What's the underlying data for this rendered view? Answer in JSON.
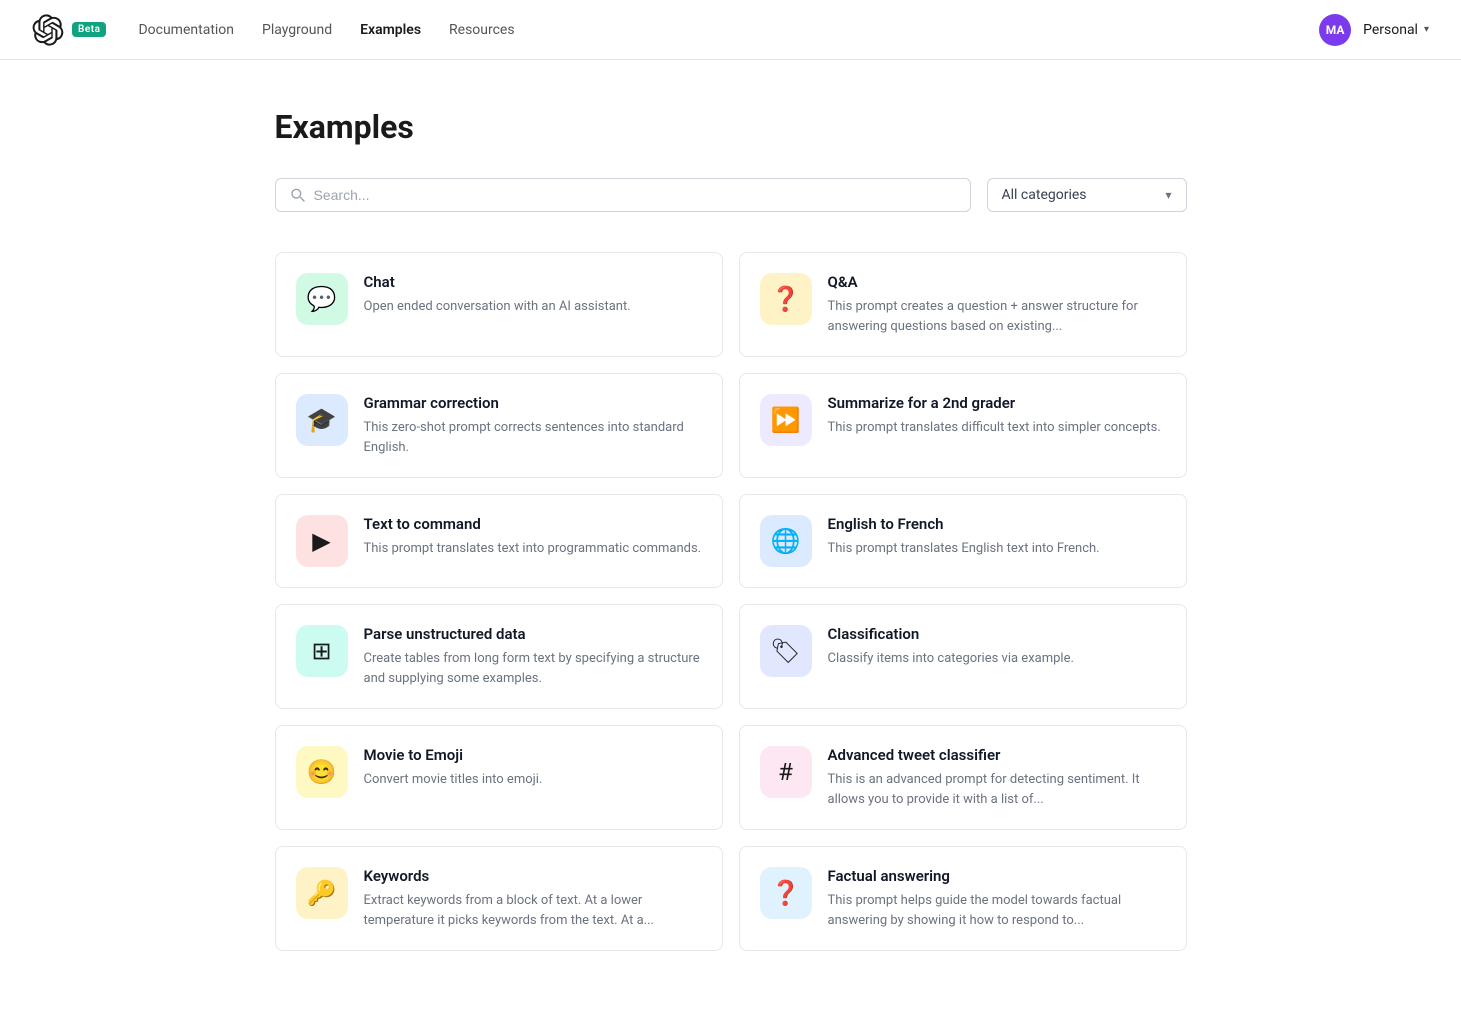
{
  "nav": {
    "logo_text": "OpenAI",
    "beta_label": "Beta",
    "links": [
      {
        "label": "Documentation",
        "active": false
      },
      {
        "label": "Playground",
        "active": false
      },
      {
        "label": "Examples",
        "active": true
      },
      {
        "label": "Resources",
        "active": false
      }
    ],
    "account_label": "Personal",
    "avatar_initials": "MA"
  },
  "page": {
    "title": "Examples",
    "search_placeholder": "Search...",
    "category_label": "All categories"
  },
  "examples": [
    {
      "id": "chat",
      "title": "Chat",
      "desc": "Open ended conversation with an AI assistant.",
      "icon": "💬",
      "bg": "bg-green"
    },
    {
      "id": "qa",
      "title": "Q&A",
      "desc": "This prompt creates a question + answer structure for answering questions based on existing...",
      "icon": "❓",
      "bg": "bg-orange"
    },
    {
      "id": "grammar",
      "title": "Grammar correction",
      "desc": "This zero-shot prompt corrects sentences into standard English.",
      "icon": "🎓",
      "bg": "bg-blue-light"
    },
    {
      "id": "summarize",
      "title": "Summarize for a 2nd grader",
      "desc": "This prompt translates difficult text into simpler concepts.",
      "icon": "⏩",
      "bg": "bg-purple"
    },
    {
      "id": "text-command",
      "title": "Text to command",
      "desc": "This prompt translates text into programmatic commands.",
      "icon": "▶",
      "bg": "bg-red"
    },
    {
      "id": "english-french",
      "title": "English to French",
      "desc": "This prompt translates English text into French.",
      "icon": "🌐",
      "bg": "bg-blue"
    },
    {
      "id": "parse",
      "title": "Parse unstructured data",
      "desc": "Create tables from long form text by specifying a structure and supplying some examples.",
      "icon": "⊞",
      "bg": "bg-teal"
    },
    {
      "id": "classification",
      "title": "Classification",
      "desc": "Classify items into categories via example.",
      "icon": "🏷",
      "bg": "bg-indigo"
    },
    {
      "id": "movie-emoji",
      "title": "Movie to Emoji",
      "desc": "Convert movie titles into emoji.",
      "icon": "😊",
      "bg": "bg-yellow"
    },
    {
      "id": "tweet-classifier",
      "title": "Advanced tweet classifier",
      "desc": "This is an advanced prompt for detecting sentiment. It allows you to provide it with a list of...",
      "icon": "#",
      "bg": "bg-pink"
    },
    {
      "id": "keywords",
      "title": "Keywords",
      "desc": "Extract keywords from a block of text. At a lower temperature it picks keywords from the text. At a...",
      "icon": "🔑",
      "bg": "bg-amber"
    },
    {
      "id": "factual",
      "title": "Factual answering",
      "desc": "This prompt helps guide the model towards factual answering by showing it how to respond to...",
      "icon": "❓",
      "bg": "bg-sky"
    }
  ]
}
